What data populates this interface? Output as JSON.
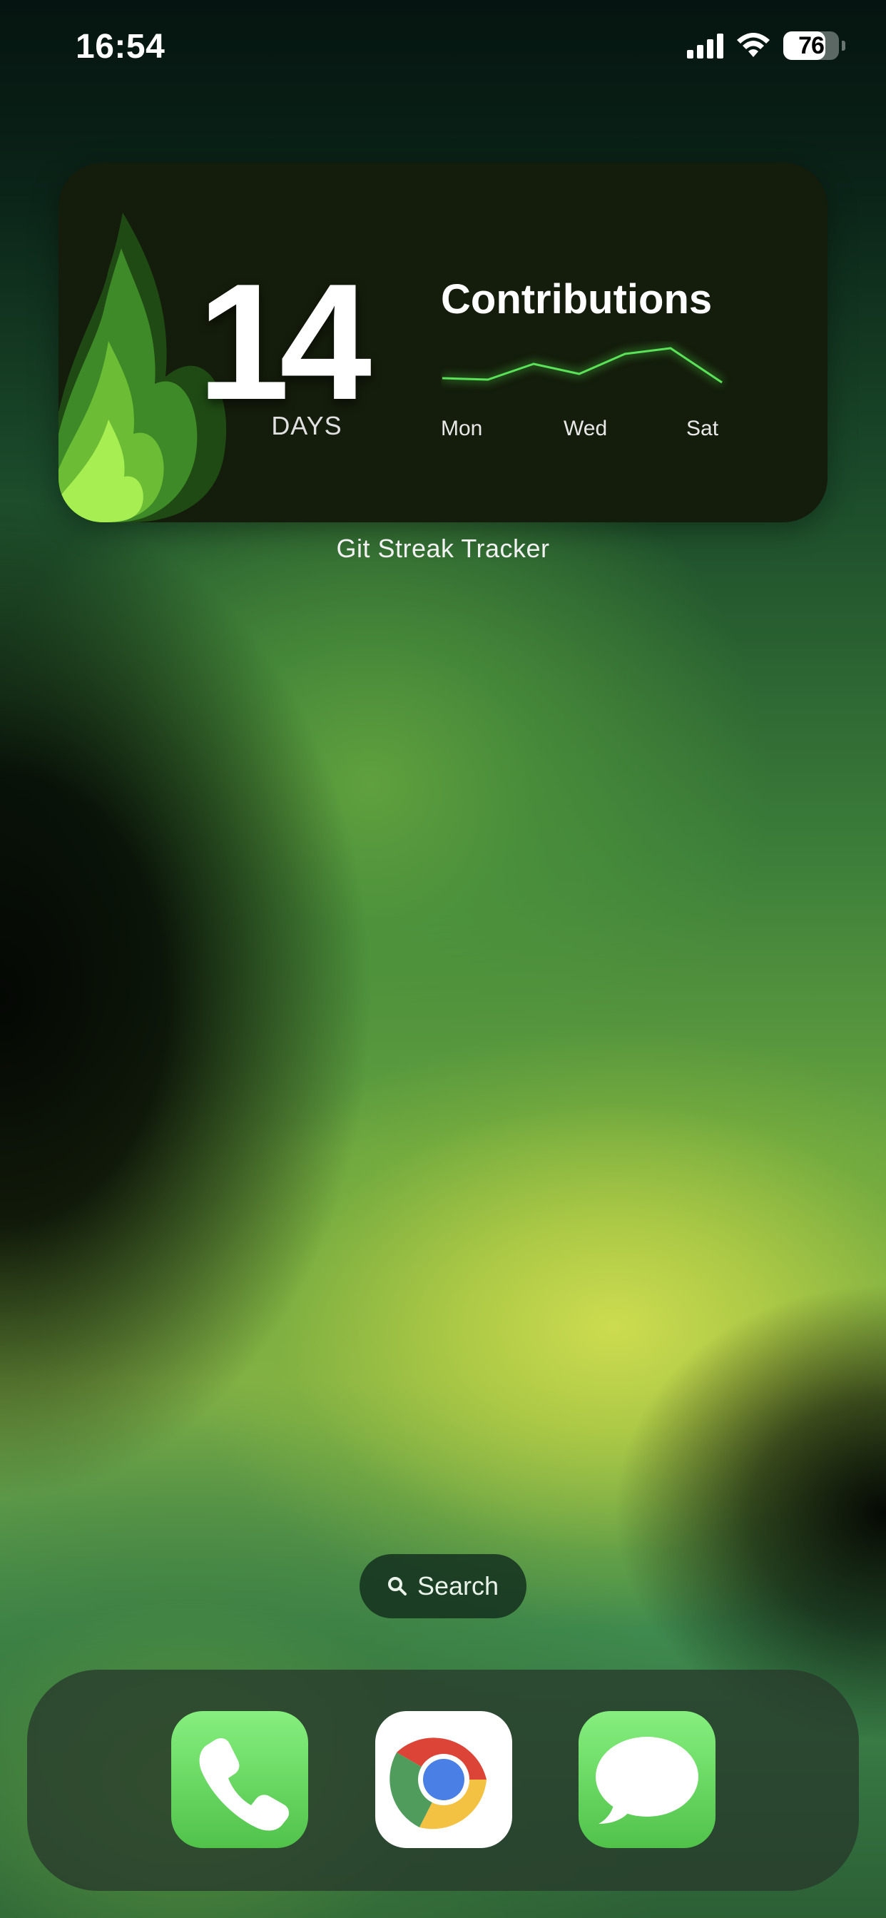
{
  "status_bar": {
    "time": "16:54",
    "battery_level": "76",
    "icons": [
      "cellular-signal-icon",
      "wifi-icon",
      "battery-icon"
    ]
  },
  "widget": {
    "streak_count": "14",
    "streak_unit": "DAYS",
    "contributions_title": "Contributions",
    "chart_day_labels": [
      "Mon",
      "Wed",
      "Sat"
    ],
    "chart_line_color": "#5ce15a",
    "caption": "Git Streak Tracker"
  },
  "search": {
    "label": "Search",
    "icon": "magnifier-icon"
  },
  "dock": {
    "apps": [
      {
        "name": "Phone",
        "icon": "phone-app-icon"
      },
      {
        "name": "Chrome",
        "icon": "chrome-app-icon"
      },
      {
        "name": "Messages",
        "icon": "messages-app-icon"
      }
    ]
  }
}
